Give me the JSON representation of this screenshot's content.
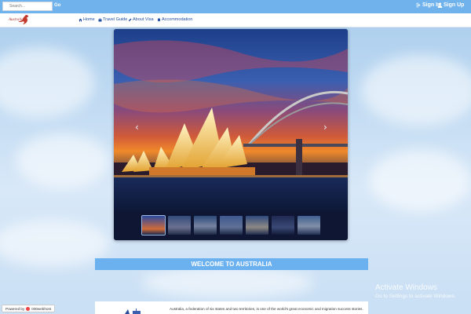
{
  "topbar": {
    "search_placeholder": "Search...",
    "go_label": "Go",
    "signin_label": "Sign In",
    "signup_label": "Sign Up"
  },
  "logo": {
    "text": "Australia"
  },
  "nav": {
    "items": [
      {
        "label": "Home",
        "icon": "home-icon"
      },
      {
        "label": "Travel Guide",
        "icon": "briefcase-icon"
      },
      {
        "label": "About Visa",
        "icon": "pencil-icon"
      },
      {
        "label": "Accommodation",
        "icon": "bookmark-icon"
      }
    ]
  },
  "slider": {
    "prev_arrow": "‹",
    "next_arrow": "›",
    "thumbnail_count": 7,
    "active_thumbnail": 1
  },
  "welcome": {
    "title": "WELCOME TO AUSTRALIA"
  },
  "content": {
    "intro": "Australia, a federation of six states and two territories, is one of the world's great economic and migration success stories."
  },
  "watermark": {
    "title": "Activate Windows",
    "subtitle": "Go to Settings to activate Windows."
  },
  "footer": {
    "powered_by": "Powered by",
    "host": "000webhost"
  },
  "colors": {
    "topbar": "#6fb2ec",
    "nav_link": "#1f4ea3",
    "welcome_band": "#6cb1ef"
  }
}
